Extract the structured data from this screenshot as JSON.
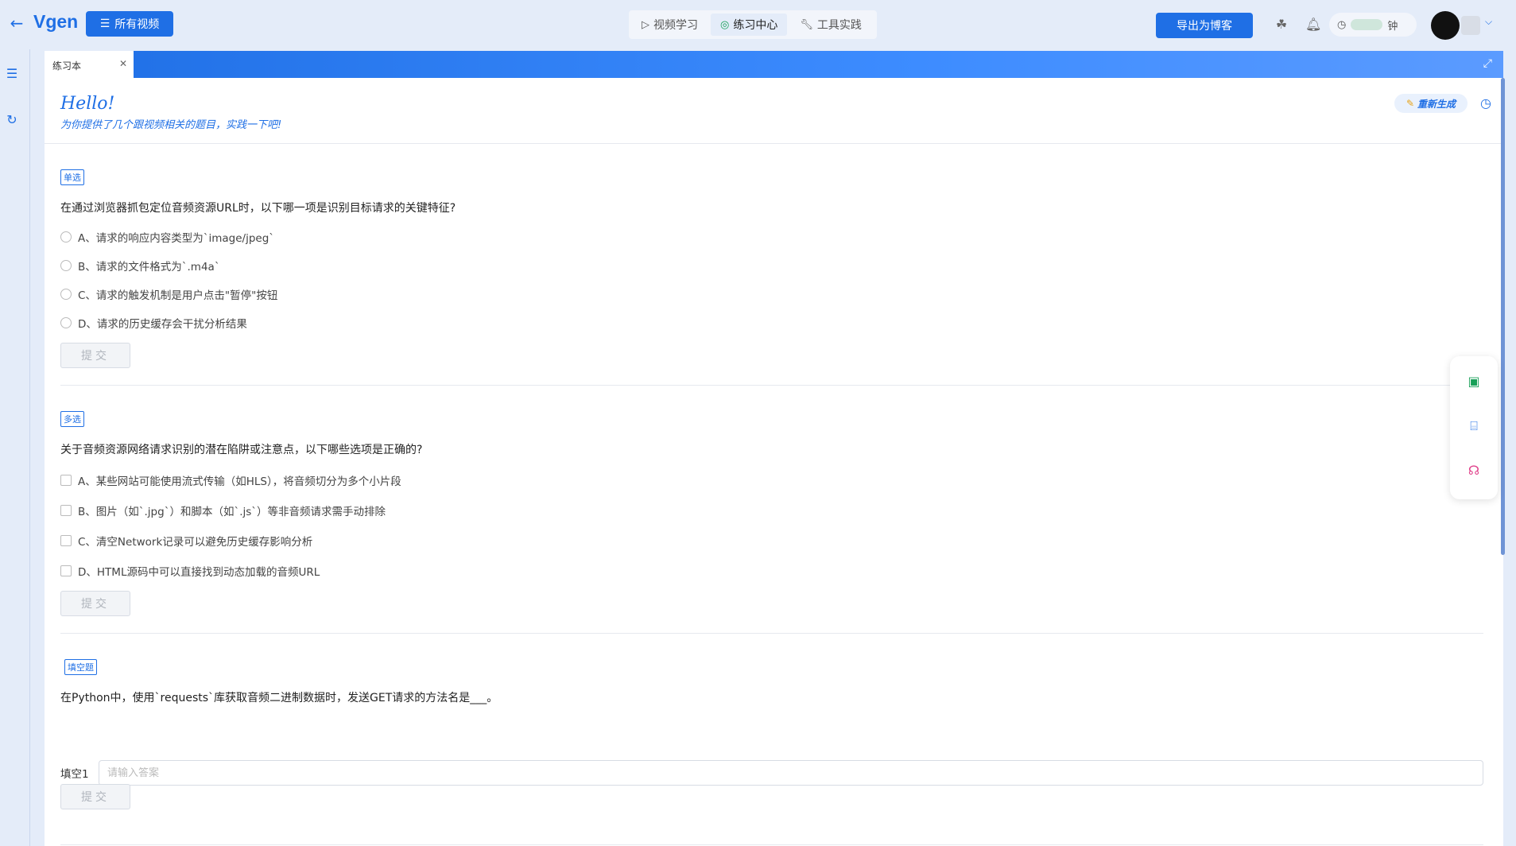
{
  "header": {
    "logo": "Vgen",
    "all_videos_label": "所有视频",
    "tabs": [
      {
        "label": "视频学习",
        "icon": "play-icon",
        "active": false
      },
      {
        "label": "练习中心",
        "icon": "target-icon",
        "active": true
      },
      {
        "label": "工具实践",
        "icon": "wrench-icon",
        "active": false
      }
    ],
    "export_label": "导出为博客",
    "timer_suffix": "钟"
  },
  "panel": {
    "tab_label": "练习本",
    "hello": "Hello!",
    "hello_sub": "为你提供了几个跟视频相关的题目，实践一下吧!",
    "regen_label": "重新生成"
  },
  "questions": [
    {
      "tag": "单选",
      "text": "在通过浏览器抓包定位音频资源URL时，以下哪一项是识别目标请求的关键特征?",
      "type": "single",
      "options": [
        "A、请求的响应内容类型为`image/jpeg`",
        "B、请求的文件格式为`.m4a`",
        "C、请求的触发机制是用户点击\"暂停\"按钮",
        "D、请求的历史缓存会干扰分析结果"
      ],
      "submit": "提交"
    },
    {
      "tag": "多选",
      "text": "关于音频资源网络请求识别的潜在陷阱或注意点，以下哪些选项是正确的?",
      "type": "multi",
      "options": [
        "A、某些网站可能使用流式传输（如HLS），将音频切分为多个小片段",
        "B、图片（如`.jpg`）和脚本（如`.js`）等非音频请求需手动排除",
        "C、清空Network记录可以避免历史缓存影响分析",
        "D、HTML源码中可以直接找到动态加载的音频URL"
      ],
      "submit": "提交"
    },
    {
      "tag": "填空题",
      "text": "在Python中，使用`requests`库获取音频二进制数据时，发送GET请求的方法名是___。",
      "type": "fill",
      "fill_label": "填空1",
      "placeholder": "请输入答案",
      "submit": "提交"
    }
  ]
}
